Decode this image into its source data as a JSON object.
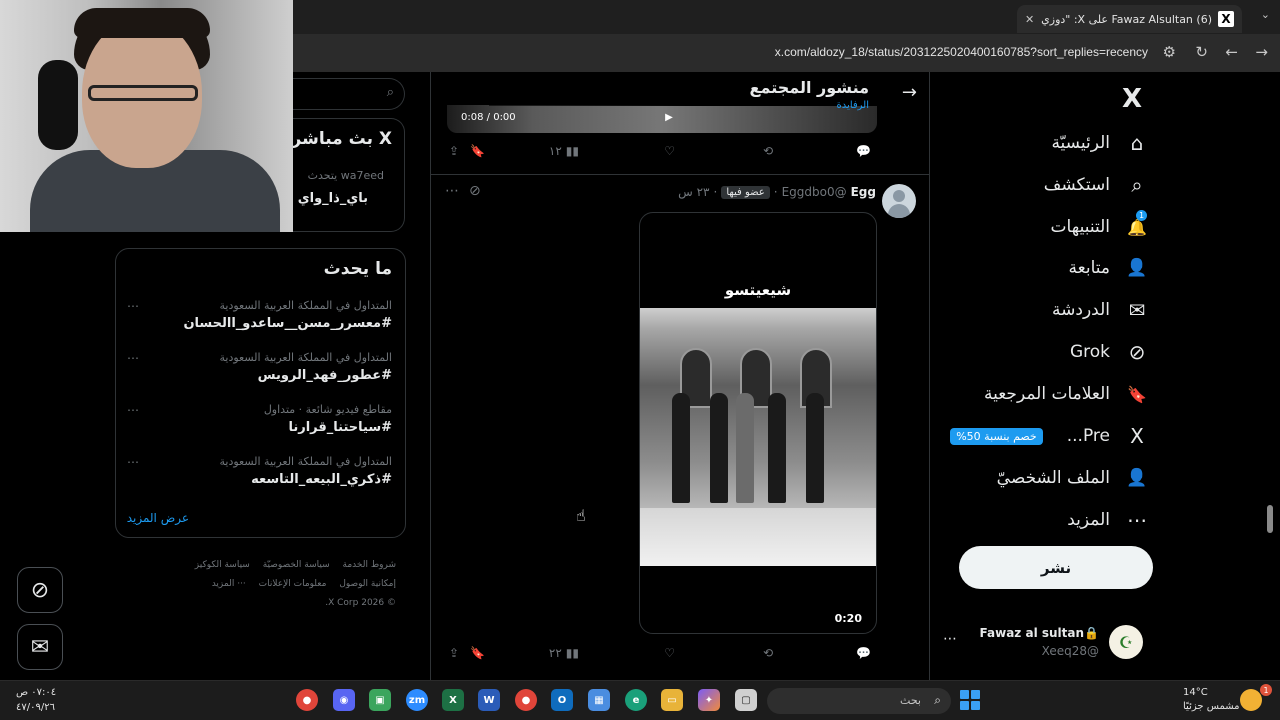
{
  "browser": {
    "tab_title": "(6) Fawaz Alsultan على X: \"دوزي",
    "tab_favicon": "X",
    "url": "x.com/aldozy_18/status/2031225020400160785?sort_replies=recency",
    "new_tab": "+",
    "close": "✕",
    "tab_list": "⌄"
  },
  "sidebar": {
    "logo": "X",
    "items": [
      {
        "label": "الرئيسيّة",
        "icon": "⌂"
      },
      {
        "label": "استكشف",
        "icon": "⌕"
      },
      {
        "label": "التنبيهات",
        "icon": "🔔",
        "badge": "1"
      },
      {
        "label": "متابعة",
        "icon": "👤"
      },
      {
        "label": "الدردشة",
        "icon": "✉"
      },
      {
        "label": "Grok",
        "icon": "⊘"
      },
      {
        "label": "العلامات المرجعية",
        "icon": "🔖"
      },
      {
        "label": "Pre...",
        "icon": "X",
        "promo": "خصم بنسبة 50%"
      },
      {
        "label": "الملف الشخصيّ",
        "icon": "👤"
      },
      {
        "label": "المزيد",
        "icon": "⋯"
      }
    ],
    "post_button": "نشر",
    "account": {
      "name": "Fawaz al sultan",
      "handle": "@Xeeq28",
      "lock": "🔒",
      "more": "⋯"
    }
  },
  "header": {
    "title": "منشور المجتمع",
    "subtitle": "الرفايدة",
    "back": "→"
  },
  "prev_post": {
    "video_time": "0:00 / 0:08",
    "actions": {
      "views": "١٢"
    }
  },
  "post": {
    "name": "Egg",
    "handle": "@Eggdbo0",
    "member_badge": "عضو فيها",
    "time": "٢٣ س",
    "media_caption": "شيعيتسو",
    "duration": "0:20",
    "actions": {
      "views": "٢٢"
    }
  },
  "right_panel": {
    "search_icon": "⌕",
    "live": {
      "title": "X بث مباشر",
      "speaker": "wa7eed يتحدث",
      "topic": "باي_ذا_واي"
    },
    "trends_title": "ما يحدث",
    "trends": [
      {
        "context": "المتداول في المملكة العربية السعودية",
        "tag": "#معسرر_مسن__ساعدو_االحسان"
      },
      {
        "context": "المتداول في المملكة العربية السعودية",
        "tag": "#عطور_فهد_الرويس"
      },
      {
        "context": "مقاطع فيديو شائعة · متداول",
        "tag": "#سياحتنا_قرارنا"
      },
      {
        "context": "المتداول في المملكة العربية السعودية",
        "tag": "#ذكري_البيعه_التاسعه"
      }
    ],
    "show_more": "عرض المزيد",
    "footer": [
      "شروط الخدمة",
      "سياسة الخصوصيّة",
      "سياسة الكوكيز",
      "إمكانية الوصول",
      "معلومات الإعلانات",
      "··· المزيد",
      "© 2026 X Corp."
    ]
  },
  "taskbar": {
    "time": "٠٧:٠٤ ص",
    "date": "٤٧/٠٩/٢٦",
    "search_placeholder": "بحث",
    "weather_temp": "14°C",
    "weather_desc": "مشمس جزئيًا",
    "weather_badge": "1",
    "apps": [
      "Chrome",
      "Discord",
      "App",
      "Zoom",
      "Excel",
      "Word",
      "Chrome",
      "Outlook",
      "Store",
      "Edge",
      "Files",
      "Copilot",
      "Window"
    ]
  }
}
